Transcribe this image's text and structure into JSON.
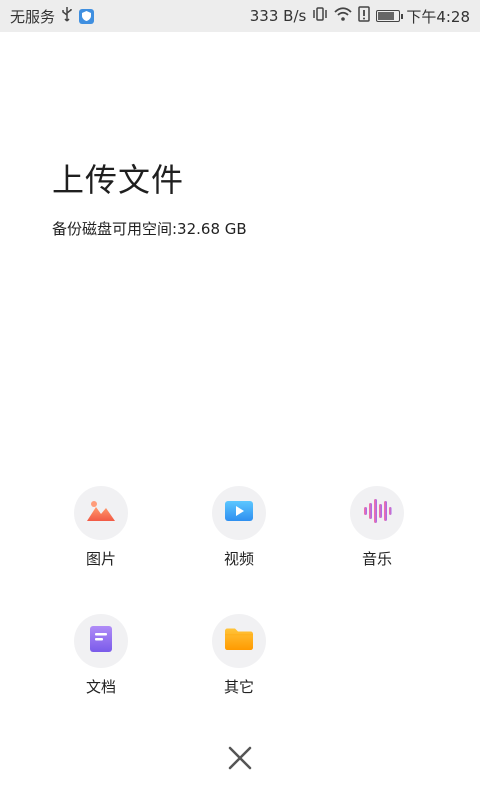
{
  "status_bar": {
    "carrier": "无服务",
    "net_speed": "333 B/s",
    "time": "下午4:28",
    "icons": [
      "usb-icon",
      "shield-icon",
      "vibrate-icon",
      "wifi-icon",
      "sim-alert-icon",
      "battery-icon"
    ]
  },
  "header": {
    "title": "上传文件",
    "space": "备份磁盘可用空间:32.68 GB"
  },
  "options": [
    {
      "label": "图片",
      "icon": "image-icon",
      "color": "#f26f4e"
    },
    {
      "label": "视频",
      "icon": "video-icon",
      "color": "#3ca5f0"
    },
    {
      "label": "音乐",
      "icon": "music-icon",
      "color": "#b569e0"
    },
    {
      "label": "文档",
      "icon": "document-icon",
      "color": "#8b6cf0"
    },
    {
      "label": "其它",
      "icon": "folder-icon",
      "color": "#ffa800"
    }
  ],
  "close": {
    "icon": "close-icon"
  }
}
